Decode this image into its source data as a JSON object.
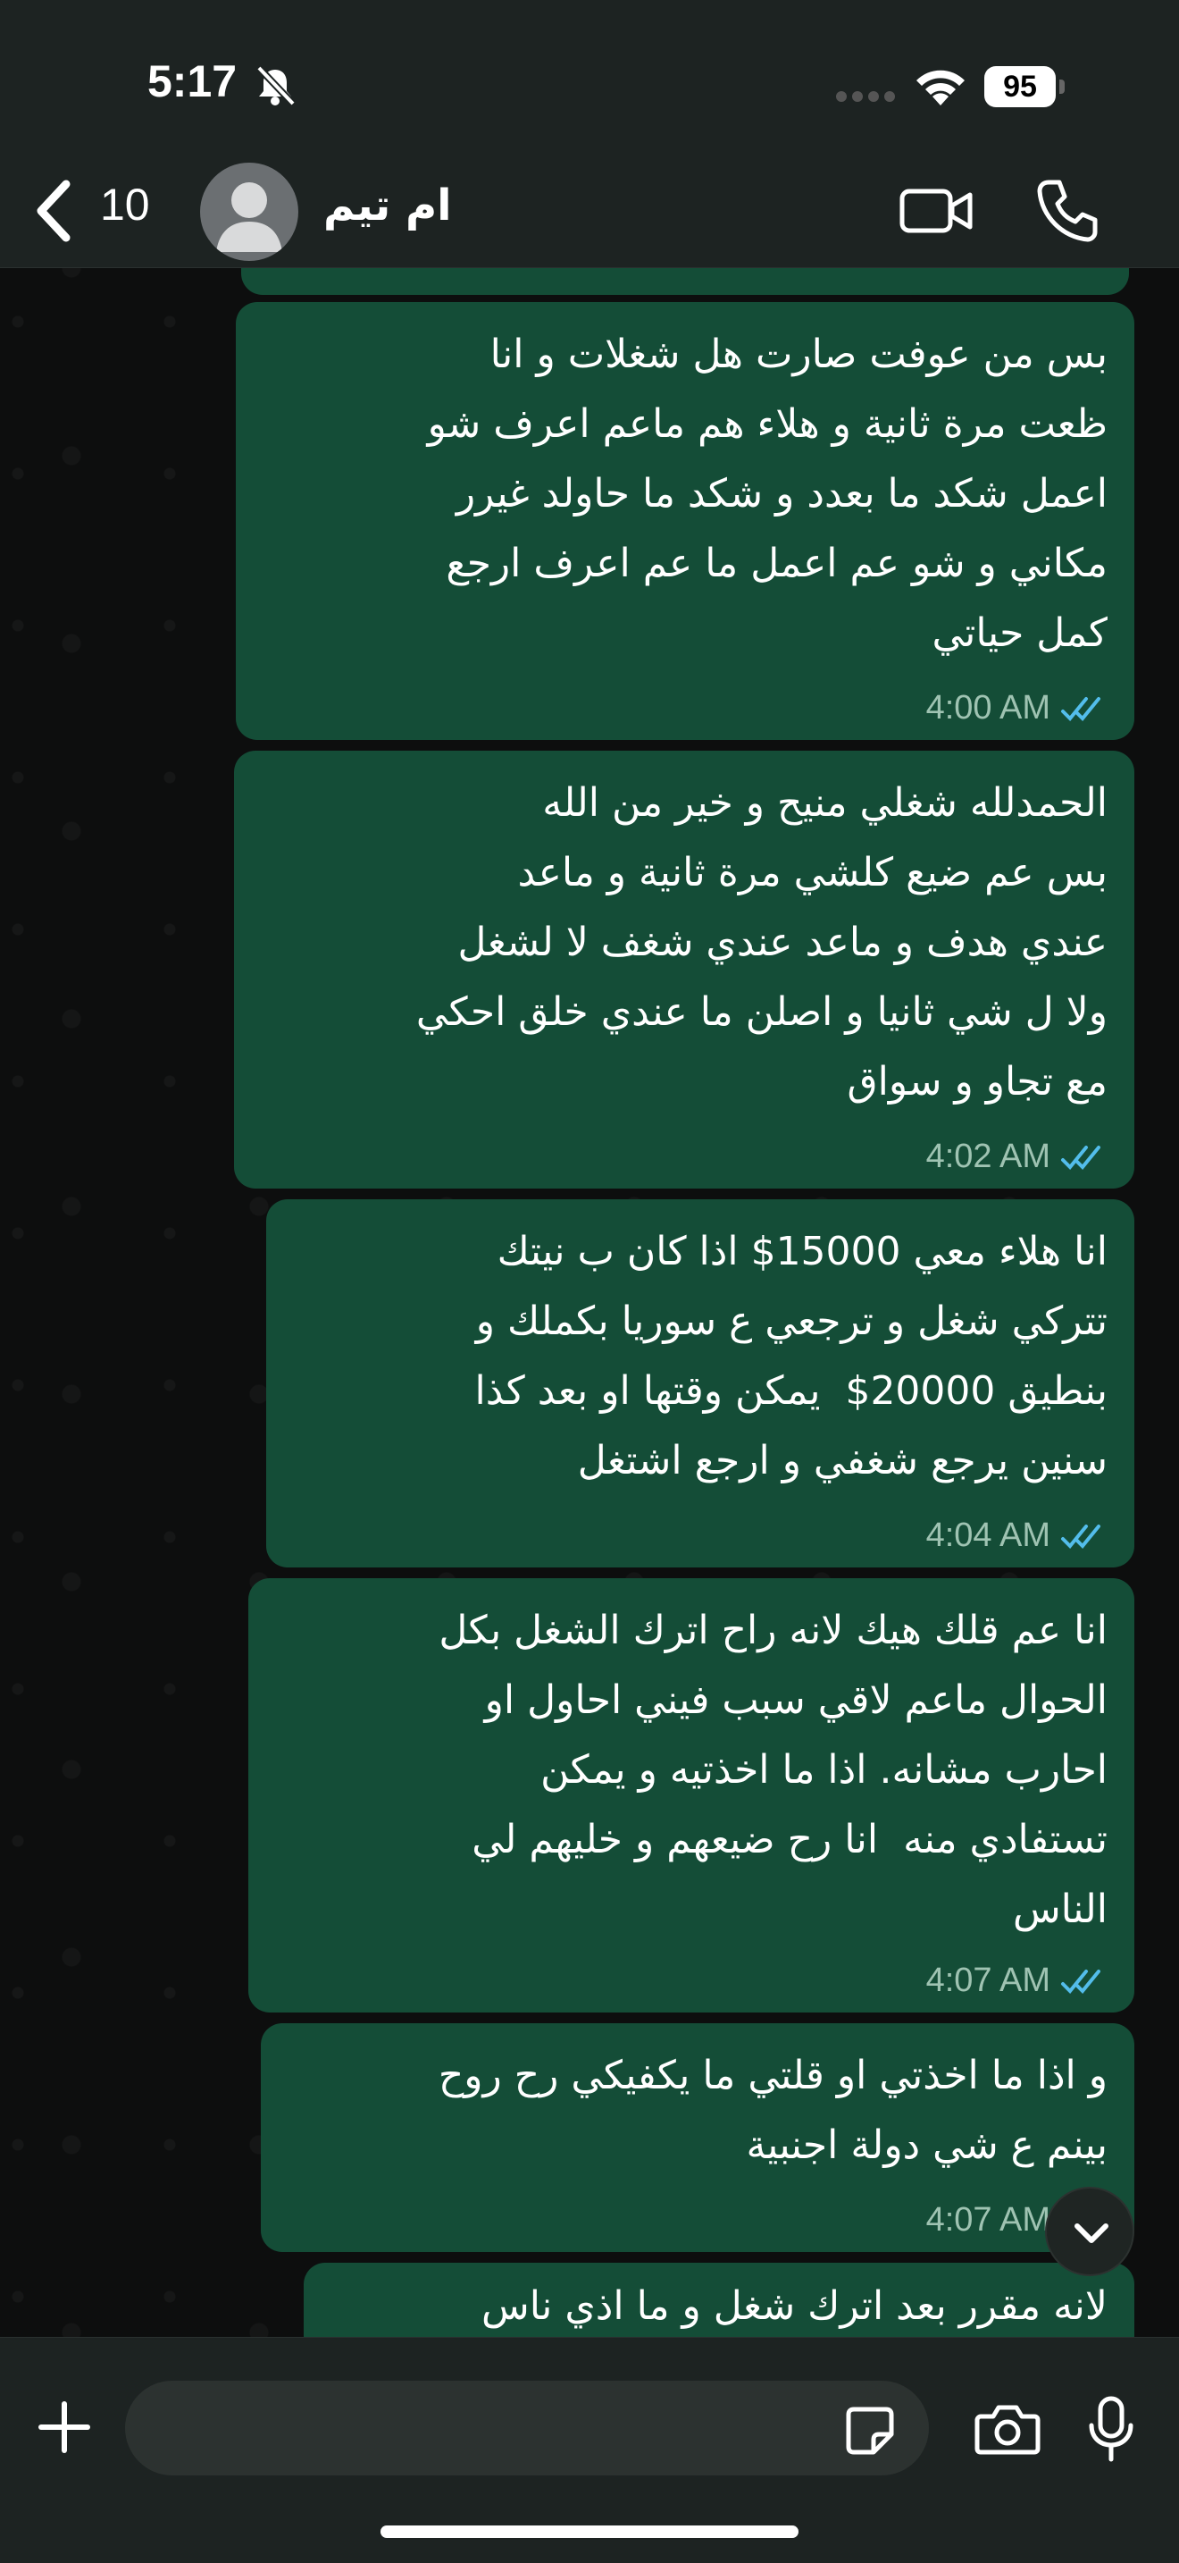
{
  "status_bar": {
    "time": "5:17",
    "battery": "95"
  },
  "header": {
    "back_count": "10",
    "contact_name": "ام تيم"
  },
  "messages": [
    {
      "text": "بس من عوفت صارت هل شغلات و انا\nظعت مرة ثانية و هلاء هم ماعم اعرف شو\nاعمل شكد ما بعدد و شكد ما حاولد غيرر\nمكاني و شو عم اعمل ما عم اعرف ارجع\nكمل حياتي",
      "time": "4:00 AM",
      "status": "read"
    },
    {
      "text": "الحمدلله شغلي منيح و خير من الله\nبس عم ضيع كلشي مرة ثانية و ماعد\nعندي هدف و ماعد عندي شغف لا لشغل\nولا ل شي ثانيا و اصلن ما عندي خلق احكي\nمع تجاو و سواق",
      "time": "4:02 AM",
      "status": "read"
    },
    {
      "text": "انا هلاء معي 15000$ اذا كان ب نيتك\nتتركي شغل و ترجعي ع سوريا بكملك و\nبنطيق 20000$  يمكن وقتها او بعد كذا\nسنين يرجع شغفي و ارجع اشتغل",
      "time": "4:04 AM",
      "status": "read"
    },
    {
      "text": "انا عم قلك هيك لانه راح اترك الشغل بكل\nالحوال ماعم لاقي سبب فيني احاول او\nاحارب مشانه. اذا ما اخذتيه و يمكن\nتستفادي منه  انا رح ضيعهم و خليهم لي\nالناس",
      "time": "4:07 AM",
      "status": "read"
    },
    {
      "text": "و اذا ما اخذتي او قلتي ما يكفيكي رح روح\nبينم ع شي دولة اجنبية",
      "time": "4:07 AM",
      "status": "read"
    },
    {
      "text": "لانه مقرر بعد اترك شغل و ما اذي ناس",
      "time": "",
      "status": ""
    }
  ],
  "composer": {
    "placeholder": ""
  },
  "icons": {
    "back": "chevron-left-icon",
    "video": "video-camera-icon",
    "phone": "phone-icon",
    "plus": "plus-icon",
    "sticker": "sticker-icon",
    "camera": "camera-icon",
    "mic": "microphone-icon",
    "read_ticks": "double-check-icon",
    "scroll_down": "chevron-down-icon"
  },
  "colors": {
    "bubble": "#144d37",
    "read_ticks": "#53bdeb",
    "bar": "#1d2322"
  }
}
